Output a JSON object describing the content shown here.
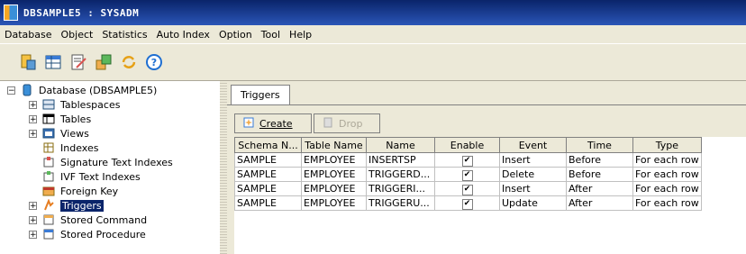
{
  "window": {
    "title": "DBSAMPLE5 : SYSADM"
  },
  "menu": [
    "Database",
    "Object",
    "Statistics",
    "Auto Index",
    "Option",
    "Tool",
    "Help"
  ],
  "toolbar": {
    "icons": [
      "database-object-icon",
      "table-grid-icon",
      "edit-document-icon",
      "export-icon",
      "refresh-icon",
      "help-icon"
    ]
  },
  "tree": {
    "root": "Database (DBSAMPLE5)",
    "items": [
      {
        "label": "Tablespaces",
        "expandable": true
      },
      {
        "label": "Tables",
        "expandable": true
      },
      {
        "label": "Views",
        "expandable": true
      },
      {
        "label": "Indexes",
        "expandable": false
      },
      {
        "label": "Signature Text Indexes",
        "expandable": false
      },
      {
        "label": "IVF Text Indexes",
        "expandable": false
      },
      {
        "label": "Foreign Key",
        "expandable": false
      },
      {
        "label": "Triggers",
        "expandable": true,
        "selected": true
      },
      {
        "label": "Stored Command",
        "expandable": true
      },
      {
        "label": "Stored Procedure",
        "expandable": true
      }
    ]
  },
  "panel": {
    "tab": "Triggers",
    "create_label": "Create",
    "drop_label": "Drop",
    "columns": [
      "Schema N...",
      "Table Name",
      "Name",
      "Enable",
      "Event",
      "Time",
      "Type"
    ],
    "rows": [
      [
        "SAMPLE",
        "EMPLOYEE",
        "INSERTSP",
        "✔",
        "Insert",
        "Before",
        "For each row"
      ],
      [
        "SAMPLE",
        "EMPLOYEE",
        "TRIGGERD...",
        "✔",
        "Delete",
        "Before",
        "For each row"
      ],
      [
        "SAMPLE",
        "EMPLOYEE",
        "TRIGGERI...",
        "✔",
        "Insert",
        "After",
        "For each row"
      ],
      [
        "SAMPLE",
        "EMPLOYEE",
        "TRIGGERU...",
        "✔",
        "Update",
        "After",
        "For each row"
      ]
    ]
  }
}
